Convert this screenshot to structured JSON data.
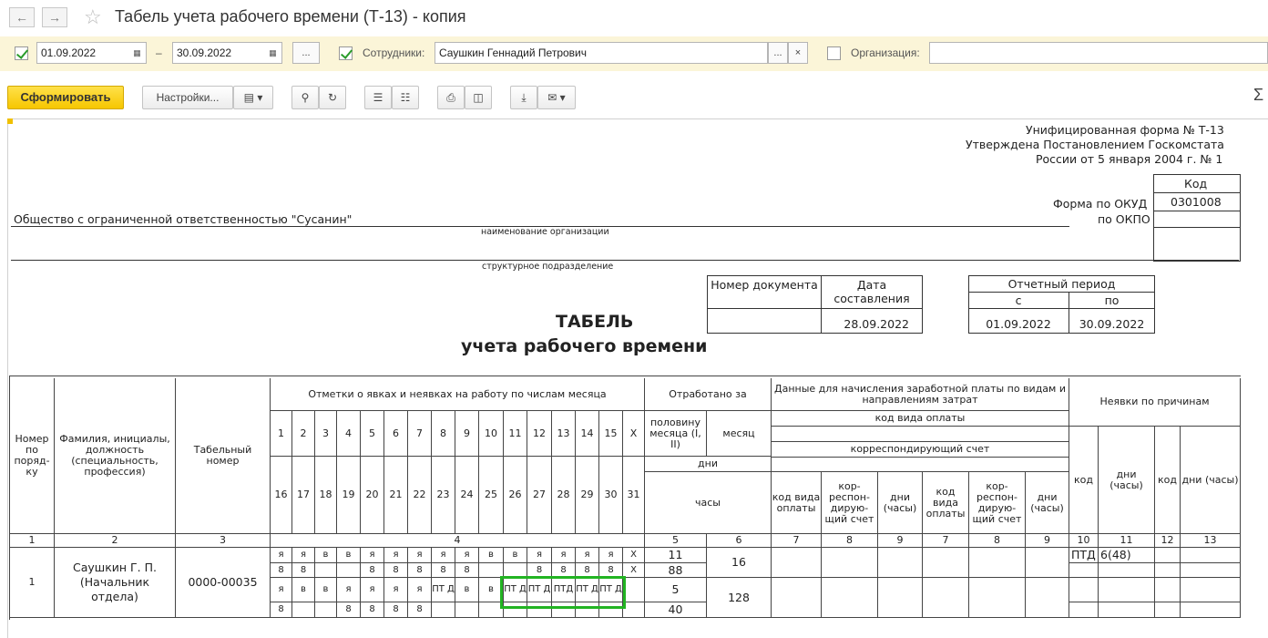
{
  "window": {
    "title": "Табель учета рабочего времени (Т-13) - копия"
  },
  "filters": {
    "period_from": "01.09.2022",
    "period_dash": "–",
    "period_to": "30.09.2022",
    "dots": "...",
    "employees_label": "Сотрудники:",
    "employees_value": "Саушкин Геннадий Петрович",
    "clear": "×",
    "organization_label": "Организация:"
  },
  "toolbar": {
    "generate": "Сформировать",
    "settings": "Настройки...",
    "sigma": "Σ"
  },
  "form": {
    "unified": "Унифицированная форма № Т-13",
    "approved": "Утверждена Постановлением Госкомстата",
    "russia": "России от 5 января 2004 г. № 1",
    "code_header": "Код",
    "okud_label": "Форма по ОКУД",
    "okud_value": "0301008",
    "okpo_label": "по ОКПО",
    "org_name": "Общество с ограниченной ответственностью \"Сусанин\"",
    "org_caption": "наименование организации",
    "dept_caption": "структурное подразделение",
    "docnum_header": "Номер документа",
    "date_header": "Дата составления",
    "date_value": "28.09.2022",
    "period_header": "Отчетный период",
    "period_from_label": "с",
    "period_to_label": "по",
    "period_from": "01.09.2022",
    "period_to": "30.09.2022",
    "title1": "ТАБЕЛЬ",
    "title2": "учета  рабочего времени"
  },
  "table": {
    "h_num": "Номер по поряд-ку",
    "h_name": "Фамилия, инициалы, должность (специальность, профессия)",
    "h_tab": "Табельный номер",
    "h_marks": "Отметки о явках и неявках на работу по числам месяца",
    "h_worked": "Отработано за",
    "h_half": "половину месяца (I, II)",
    "h_month": "месяц",
    "h_days": "дни",
    "h_hours": "часы",
    "h_payroll": "Данные для начисления заработной платы по видам и направлениям затрат",
    "h_paycode": "код вида оплаты",
    "h_corr": "корреспондирующий счет",
    "h_kvo": "код вида оплаты",
    "h_korr": "кор-респон-дирую-щий счет",
    "h_dni": "дни (часы)",
    "h_absence": "Неявки по причинам",
    "h_kod": "код",
    "h_dni2": "дни (часы)",
    "days1": [
      "1",
      "2",
      "3",
      "4",
      "5",
      "6",
      "7",
      "8",
      "9",
      "10",
      "11",
      "12",
      "13",
      "14",
      "15",
      "X"
    ],
    "days2": [
      "16",
      "17",
      "18",
      "19",
      "20",
      "21",
      "22",
      "23",
      "24",
      "25",
      "26",
      "27",
      "28",
      "29",
      "30",
      "31"
    ],
    "colnums": [
      "1",
      "2",
      "3",
      "4",
      "5",
      "6",
      "7",
      "8",
      "9",
      "7",
      "8",
      "9",
      "10",
      "11",
      "12",
      "13"
    ],
    "row": {
      "num": "1",
      "name": "Саушкин Г. П. (Начальник отдела)",
      "tabnum": "0000-00035",
      "r1": [
        "я",
        "я",
        "в",
        "в",
        "я",
        "я",
        "я",
        "я",
        "я",
        "в",
        "в",
        "я",
        "я",
        "я",
        "я",
        "X"
      ],
      "r2": [
        "8",
        "8",
        "",
        "",
        "8",
        "8",
        "8",
        "8",
        "8",
        "",
        "",
        "8",
        "8",
        "8",
        "8",
        "X"
      ],
      "r3": [
        "я",
        "в",
        "в",
        "я",
        "я",
        "я",
        "я",
        "ПТ Д",
        "в",
        "в",
        "ПТ Д",
        "ПТ Д",
        "ПТД",
        "ПТ Д",
        "ПТ Д",
        ""
      ],
      "r4": [
        "8",
        "",
        "",
        "8",
        "8",
        "8",
        "8",
        "",
        "",
        "",
        "",
        "",
        "",
        "",
        "",
        ""
      ],
      "half1_days": "11",
      "half1_hours": "88",
      "month_days": "16",
      "half2_days": "5",
      "half2_hours": "40",
      "month_hours": "128",
      "abs_code": "ПТД",
      "abs_days": "6(48)"
    }
  }
}
